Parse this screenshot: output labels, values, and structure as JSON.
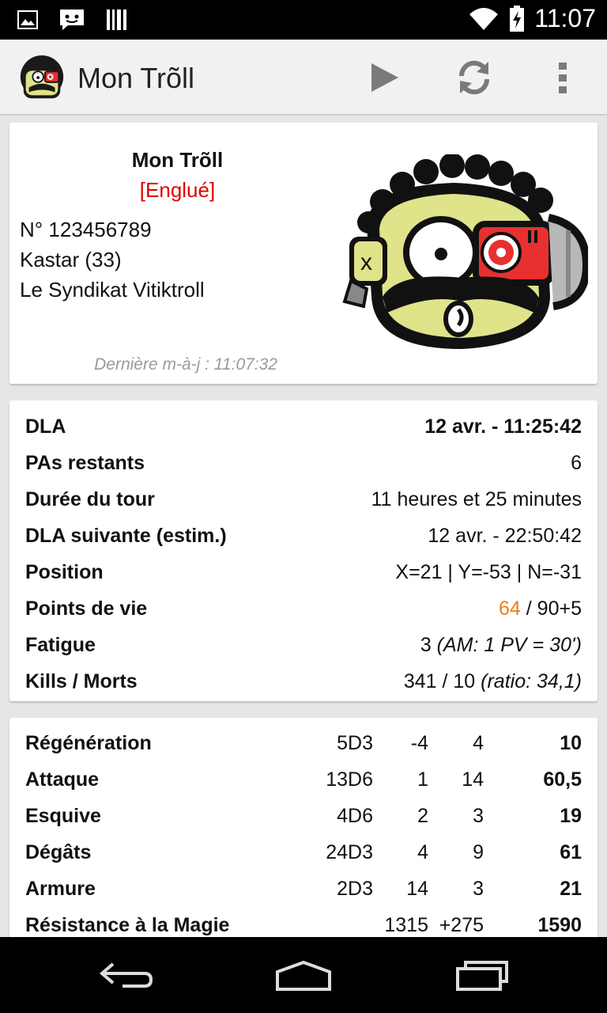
{
  "status_bar": {
    "time": "11:07"
  },
  "action_bar": {
    "title": "Mon Trõll"
  },
  "profile": {
    "name": "Mon Trõll",
    "status": "[Englué]",
    "number": "N° 123456789",
    "race": "Kastar (33)",
    "guild": "Le Syndikat Vitiktroll",
    "last_update": "Dernière m-à-j : 11:07:32"
  },
  "stats": {
    "dla_label": "DLA",
    "dla_value": "12 avr. - 11:25:42",
    "pa_label": "PAs restants",
    "pa_value": "6",
    "duree_label": "Durée du tour",
    "duree_value": "11 heures et 25 minutes",
    "dla_next_label": "DLA suivante (estim.)",
    "dla_next_value": "12 avr. - 22:50:42",
    "position_label": "Position",
    "position_value": "X=21 | Y=-53 | N=-31",
    "pv_label": "Points de vie",
    "pv_current": "64",
    "pv_max": " / 90+5",
    "fatigue_label": "Fatigue",
    "fatigue_value": "3 ",
    "fatigue_note": "(AM: 1 PV = 30')",
    "kills_label": "Kills / Morts",
    "kills_value": "341 / 10 ",
    "kills_note": "(ratio: 34,1)"
  },
  "characteristics": [
    {
      "label": "Régénération",
      "dice": "5D3",
      "bonus1": "-4",
      "bonus2": "4",
      "total": "10"
    },
    {
      "label": "Attaque",
      "dice": "13D6",
      "bonus1": "1",
      "bonus2": "14",
      "total": "60,5"
    },
    {
      "label": "Esquive",
      "dice": "4D6",
      "bonus1": "2",
      "bonus2": "3",
      "total": "19"
    },
    {
      "label": "Dégâts",
      "dice": "24D3",
      "bonus1": "4",
      "bonus2": "9",
      "total": "61"
    },
    {
      "label": "Armure",
      "dice": "2D3",
      "bonus1": "14",
      "bonus2": "3",
      "total": "21"
    },
    {
      "label": "Résistance à la Magie",
      "dice": "",
      "bonus1": "1315",
      "bonus2": "+275",
      "total": "1590"
    }
  ],
  "colors": {
    "status_red": "#e00000",
    "pv_orange": "#f07e10",
    "muted": "#9a9a9a"
  }
}
